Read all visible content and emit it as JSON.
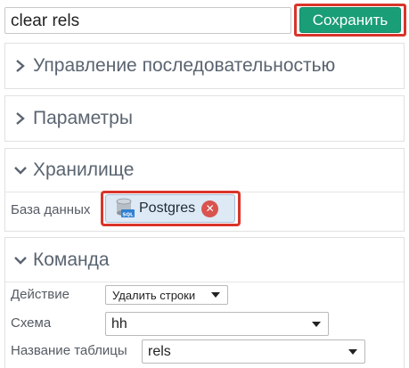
{
  "toolbar": {
    "name_value": "clear rels",
    "save_label": "Сохранить"
  },
  "sections": {
    "sequence": {
      "title": "Управление последовательностью"
    },
    "params": {
      "title": "Параметры"
    },
    "storage": {
      "title": "Хранилище",
      "db_label": "База данных",
      "db_value": "Postgres",
      "db_icon": "database-sql-icon",
      "db_icon_text": "SQL"
    },
    "command": {
      "title": "Команда",
      "action_label": "Действие",
      "action_value": "Удалить строки",
      "schema_label": "Схема",
      "schema_value": "hh",
      "table_label": "Название таблицы",
      "table_value": "rels"
    }
  },
  "colors": {
    "accent": "#1a9e77",
    "highlight": "#d9342b",
    "tag_bg": "#dde9f5",
    "remove": "#d9534f"
  }
}
